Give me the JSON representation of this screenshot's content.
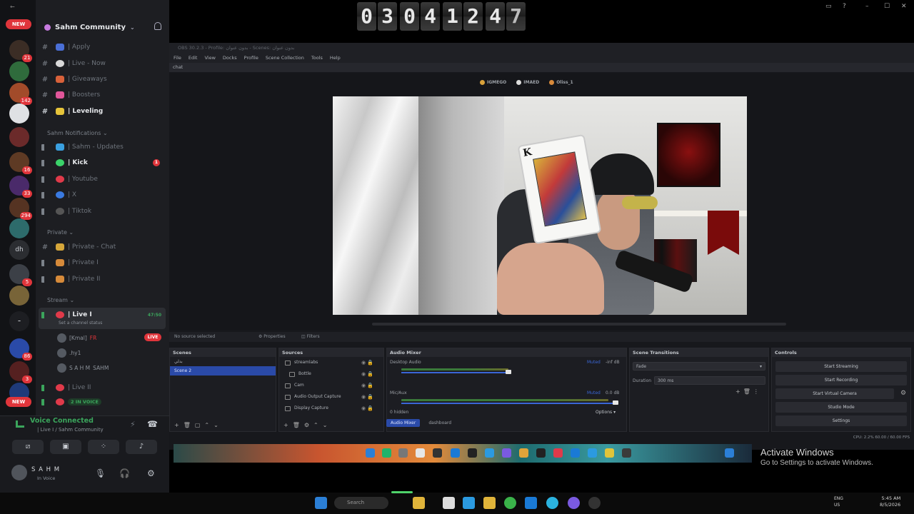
{
  "timer": {
    "digits": [
      "0",
      "3",
      "0",
      "4",
      "1",
      "2",
      "4",
      "7"
    ]
  },
  "discord": {
    "server_name": "Sahm Community",
    "new_badge": "NEW",
    "server_badges": [
      "21",
      "142",
      "16",
      "33",
      "294",
      "5",
      "86",
      "3"
    ],
    "rail_label": "dh",
    "channels": [
      {
        "name": "| Apply",
        "type": "text"
      },
      {
        "name": "| Live - Now",
        "type": "text"
      },
      {
        "name": "| Giveaways",
        "type": "text"
      },
      {
        "name": "| Boosters",
        "type": "text"
      },
      {
        "name": "| Leveling",
        "type": "text",
        "bright": true
      }
    ],
    "cat_notifications": "Sahm Notifications",
    "notif_channels": [
      {
        "name": "| Sahm - Updates"
      },
      {
        "name": "| Kick",
        "bright": true,
        "badge": "1"
      },
      {
        "name": "| Youtube"
      },
      {
        "name": "| X"
      },
      {
        "name": "| Tiktok"
      }
    ],
    "cat_private": "Private",
    "private_channels": [
      {
        "name": "| Private - Chat"
      },
      {
        "name": "| Private I"
      },
      {
        "name": "| Private II"
      }
    ],
    "cat_stream": "Stream",
    "live_channel": "| Live I",
    "live_time": "47:50",
    "live_status": "Set a channel status",
    "voice_members": [
      "[Kmal]",
      ".hy1",
      "S A H M"
    ],
    "voice_tags": {
      "fr": "FR",
      "sahm": "SAHM"
    },
    "live_badge": "LIVE",
    "live_ii": "| Live II",
    "in_voice": "2 IN VOICE",
    "voice_connected": "Voice Connected",
    "voice_location": "| Live I / Sahm Community",
    "user_name": "S A H M",
    "user_status": "In Voice"
  },
  "obs": {
    "title": "OBS 30.2.3 - Profile: بدون عنوان - Scenes: بدون عنوان",
    "menu": [
      "File",
      "Edit",
      "View",
      "Docks",
      "Profile",
      "Scene Collection",
      "Tools",
      "Help"
    ],
    "dock_title": "chat",
    "chat_users": [
      "IGMEGO",
      "IMAED",
      "Oliss_1"
    ],
    "no_source": "No source selected",
    "properties": "Properties",
    "filters": "Filters",
    "card_letter": "K",
    "scenes_title": "Scenes",
    "scenes": [
      "بدلي",
      "Scene 2"
    ],
    "sources_title": "Sources",
    "sources": [
      "streamlabs",
      "Bottle",
      "Cam",
      "Audio Output Capture",
      "Display Capture"
    ],
    "mixer_title": "Audio Mixer",
    "mixer_channels": [
      {
        "name": "Desktop Audio",
        "level": "Muted",
        "db": "-inf dB"
      },
      {
        "name": "Mic/Aux",
        "level": "Muted",
        "db": "0.0 dB"
      }
    ],
    "hidden_count": "0 hidden",
    "options": "Options",
    "mixer_tabs": [
      "Audio Mixer",
      "dashboard"
    ],
    "transitions_title": "Scene Transitions",
    "transition": "Fade",
    "duration_label": "Duration",
    "duration": "300 ms",
    "controls_title": "Controls",
    "controls": [
      "Start Streaming",
      "Start Recording",
      "Start Virtual Camera",
      "Studio Mode",
      "Settings"
    ],
    "status": "CPU: 2.2%   60.00 / 60.00 FPS"
  },
  "activate": {
    "title": "Activate Windows",
    "subtitle": "Go to Settings to activate Windows."
  },
  "taskbar": {
    "search": "Search",
    "lang": "ENG",
    "region": "US",
    "time": "5:45 AM",
    "date": "8/5/2026"
  },
  "colors": {
    "discord_bg": "#1d1e22",
    "obs_bg": "#17181c",
    "accent_red": "#e0353b",
    "voice_green": "#3ba55c",
    "obs_select": "#2a4aa8"
  }
}
